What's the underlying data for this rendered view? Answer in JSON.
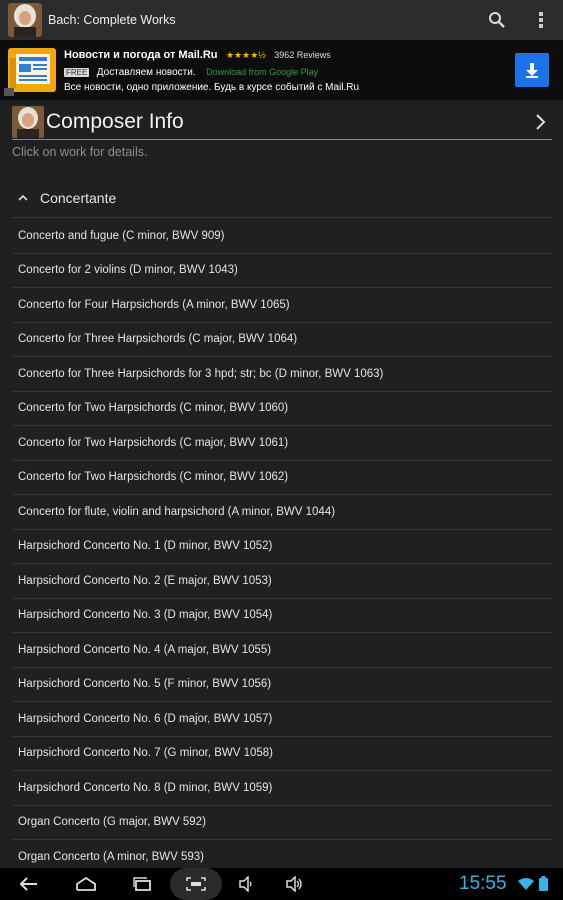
{
  "app": {
    "title": "Bach: Complete Works",
    "icon": "bach-portrait-icon"
  },
  "actionbar": {
    "search_icon": "search-icon",
    "overflow_icon": "overflow-menu-icon"
  },
  "ad": {
    "title": "Новости и погода от Mail.Ru",
    "stars": "★★★★½",
    "reviews": "3962 Reviews",
    "free_badge": "FREE",
    "subtitle": "Доставляем новости.",
    "store_text": "Download from Google Play",
    "description": "Все новости, одно приложение. Будь в курсе событий с Mail.Ru",
    "download_icon": "download-icon",
    "colors": {
      "download_bg": "#1a73e8",
      "stars": "#f4b400",
      "store": "#2e9a3a"
    }
  },
  "composer": {
    "title": "Composer Info",
    "hint": "Click on work for details."
  },
  "group": {
    "title": "Concertante"
  },
  "works": [
    "Concerto and fugue (C minor, BWV 909)",
    "Concerto for 2 violins (D minor, BWV 1043)",
    "Concerto for Four Harpsichords (A minor, BWV 1065)",
    "Concerto for Three Harpsichords (C major, BWV 1064)",
    "Concerto for Three Harpsichords for 3 hpd; str; bc (D minor, BWV 1063)",
    "Concerto for Two Harpsichords (C minor, BWV 1060)",
    "Concerto for Two Harpsichords (C major, BWV 1061)",
    "Concerto for Two Harpsichords (C minor, BWV 1062)",
    "Concerto for flute, violin and harpsichord (A minor, BWV 1044)",
    "Harpsichord Concerto No. 1 (D minor, BWV 1052)",
    "Harpsichord Concerto No. 2 (E major, BWV 1053)",
    "Harpsichord Concerto No. 3 (D major, BWV 1054)",
    "Harpsichord Concerto No. 4 (A major, BWV 1055)",
    "Harpsichord Concerto No. 5 (F minor, BWV 1056)",
    "Harpsichord Concerto No. 6 (D major, BWV 1057)",
    "Harpsichord Concerto No. 7 (G minor, BWV 1058)",
    "Harpsichord Concerto No. 8 (D minor, BWV 1059)",
    "Organ Concerto (G major, BWV 592)",
    "Organ Concerto (A minor, BWV 593)"
  ],
  "system": {
    "clock": "15:55",
    "accent": "#35b5e5"
  }
}
